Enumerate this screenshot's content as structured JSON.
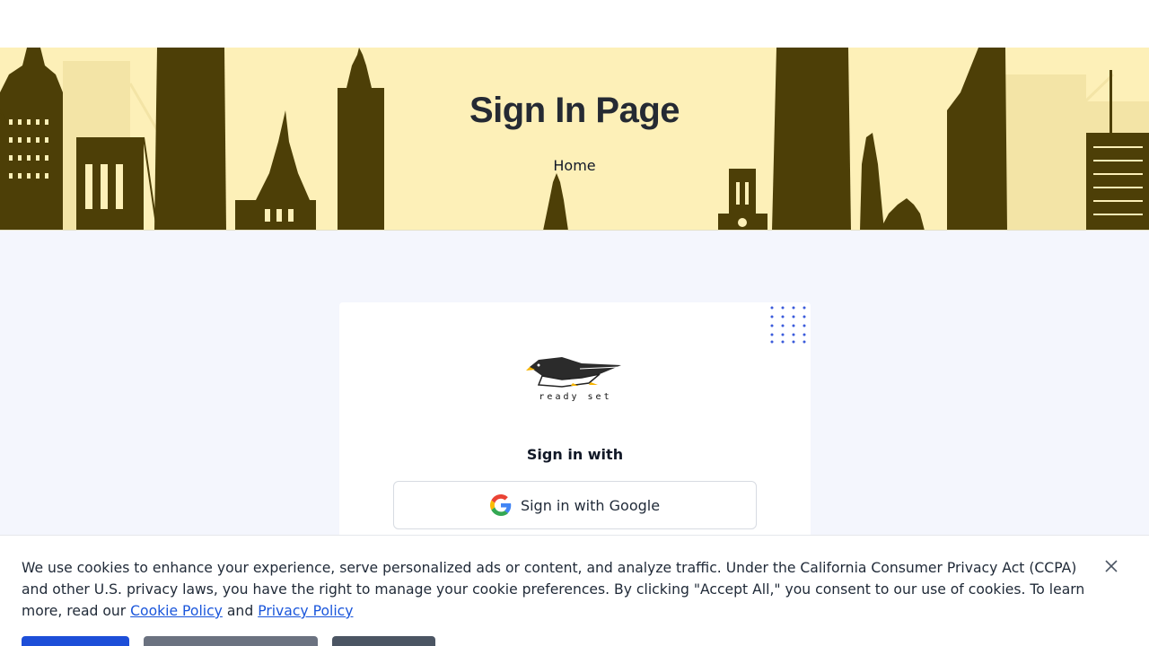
{
  "hero": {
    "title": "Sign In Page",
    "breadcrumb": "Home"
  },
  "card": {
    "logo_text": "ready set",
    "sign_in_with": "Sign in with",
    "google_button_label": "Sign in with Google"
  },
  "cookie_banner": {
    "text_before": "We use cookies to enhance your experience, serve personalized ads or content, and analyze traffic. Under the California Consumer Privacy Act (CCPA) and other U.S. privacy laws, you have the right to manage your cookie preferences. By clicking \"Accept All,\" you consent to our use of cookies. To learn more, read our ",
    "cookie_policy_link": "Cookie Policy",
    "and_text": " and ",
    "privacy_policy_link": "Privacy Policy"
  },
  "icons": {
    "google": "google-g-icon",
    "close": "close-icon",
    "logo": "penguin-logo-icon"
  },
  "colors": {
    "hero_bg": "#fdf0b8",
    "skyline": "#4d3f07",
    "skyline_light": "#f0e2a8",
    "page_bg": "#f4f6fd",
    "dots": "#3b5bdb",
    "link": "#1a56db",
    "accept_button": "#1d4ed8"
  }
}
